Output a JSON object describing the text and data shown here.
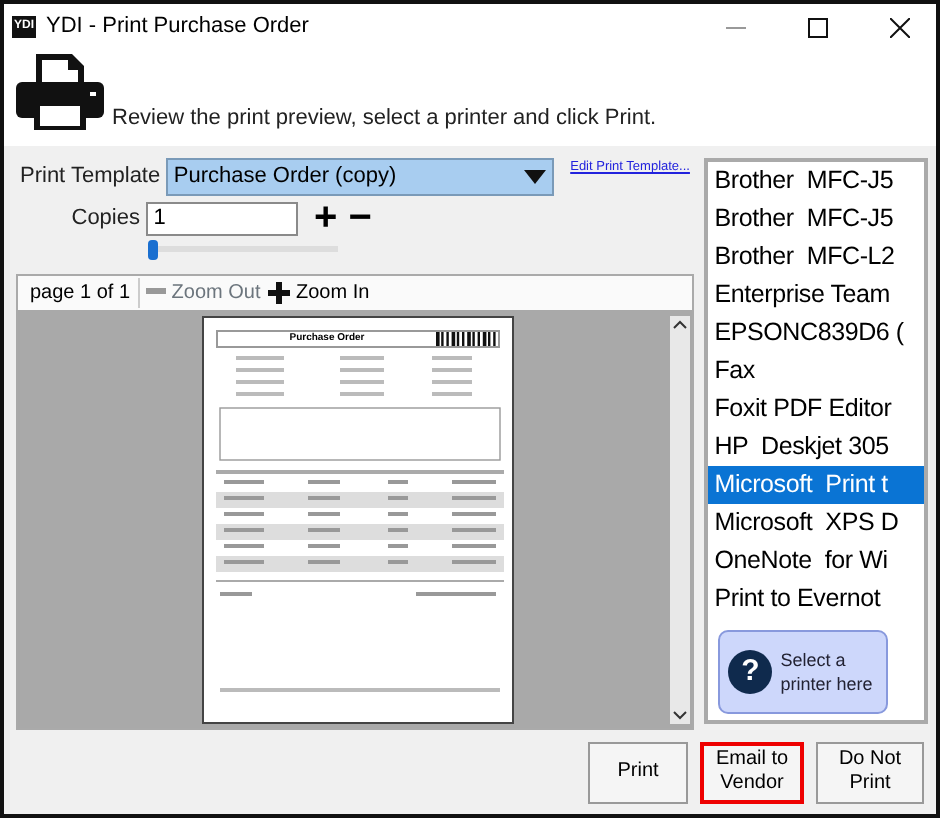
{
  "window": {
    "title": "YDI - Print Purchase Order",
    "app_badge": "YDI"
  },
  "instruction": "Review the print preview, select a printer and click Print.",
  "template": {
    "label": "Print Template",
    "value": "Purchase Order  (copy)",
    "edit_link": "Edit Print Template..."
  },
  "copies": {
    "label": "Copies",
    "value": "1",
    "plus": "+",
    "minus": "−",
    "slider": {
      "level": 0
    }
  },
  "preview": {
    "page_label": "page 1 of 1",
    "zoom_out": "Zoom Out",
    "zoom_in": "Zoom In",
    "document_title": "Purchase Order"
  },
  "printers": [
    {
      "name": "Brother  MFC-J5",
      "selected": false
    },
    {
      "name": "Brother  MFC-J5",
      "selected": false
    },
    {
      "name": "Brother  MFC-L2",
      "selected": false
    },
    {
      "name": "Enterprise Team",
      "selected": false
    },
    {
      "name": "EPSONC839D6 (",
      "selected": false
    },
    {
      "name": "Fax",
      "selected": false
    },
    {
      "name": "Foxit PDF Editor",
      "selected": false
    },
    {
      "name": "HP  Deskjet 305",
      "selected": false
    },
    {
      "name": "Microsoft  Print t",
      "selected": true
    },
    {
      "name": "Microsoft  XPS D",
      "selected": false
    },
    {
      "name": "OneNote  for Wi",
      "selected": false
    },
    {
      "name": "Print to Evernot",
      "selected": false
    }
  ],
  "hint": {
    "icon": "?",
    "text": "Select a printer here"
  },
  "buttons": [
    {
      "label": "Print",
      "highlighted": false
    },
    {
      "label": "Email to Vendor",
      "highlighted": true
    },
    {
      "label": "Do Not Print",
      "highlighted": false
    }
  ]
}
